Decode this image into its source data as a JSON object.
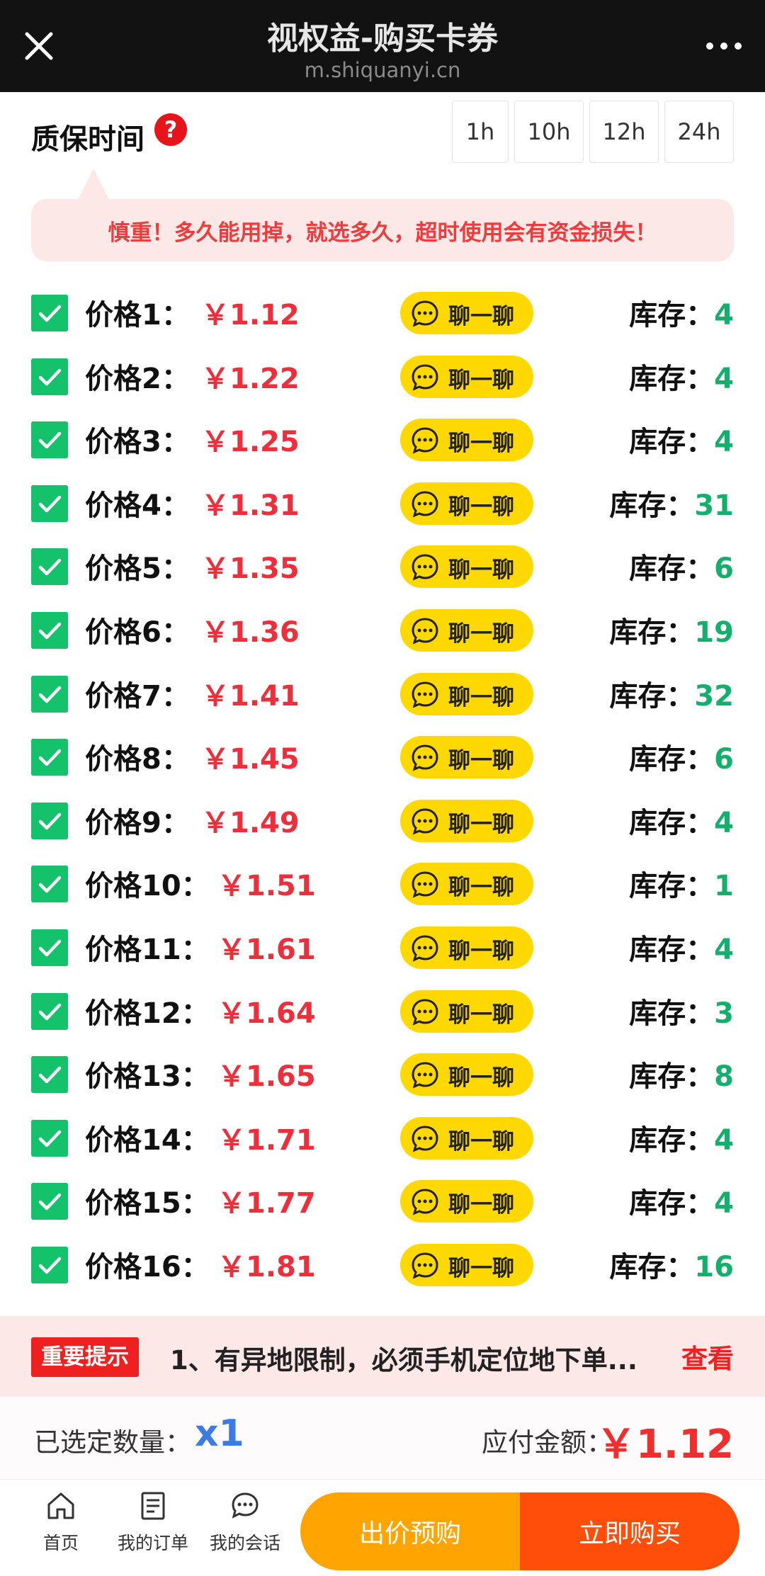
{
  "titlebar": {
    "title": "视权益-购买卡券",
    "url": "m.shiquanyi.cn"
  },
  "warranty": {
    "label": "质保时间",
    "help": "?",
    "options": [
      "1h",
      "10h",
      "12h",
      "24h"
    ],
    "notice": "慎重！多久能用掉，就选多久，超时使用会有资金损失！"
  },
  "list": {
    "chat_label": "聊一聊",
    "stock_label": "库存：",
    "items": [
      {
        "label": "价格1：",
        "price": "￥1.12",
        "stock": "4"
      },
      {
        "label": "价格2：",
        "price": "￥1.22",
        "stock": "4"
      },
      {
        "label": "价格3：",
        "price": "￥1.25",
        "stock": "4"
      },
      {
        "label": "价格4：",
        "price": "￥1.31",
        "stock": "31"
      },
      {
        "label": "价格5：",
        "price": "￥1.35",
        "stock": "6"
      },
      {
        "label": "价格6：",
        "price": "￥1.36",
        "stock": "19"
      },
      {
        "label": "价格7：",
        "price": "￥1.41",
        "stock": "32"
      },
      {
        "label": "价格8：",
        "price": "￥1.45",
        "stock": "6"
      },
      {
        "label": "价格9：",
        "price": "￥1.49",
        "stock": "4"
      },
      {
        "label": "价格10：",
        "price": "￥1.51",
        "stock": "1"
      },
      {
        "label": "价格11：",
        "price": "￥1.61",
        "stock": "4"
      },
      {
        "label": "价格12：",
        "price": "￥1.64",
        "stock": "3"
      },
      {
        "label": "价格13：",
        "price": "￥1.65",
        "stock": "8"
      },
      {
        "label": "价格14：",
        "price": "￥1.71",
        "stock": "4"
      },
      {
        "label": "价格15：",
        "price": "￥1.77",
        "stock": "4"
      },
      {
        "label": "价格16：",
        "price": "￥1.81",
        "stock": "16"
      }
    ]
  },
  "tip": {
    "badge": "重要提示",
    "text": "1、有异地限制，必须手机定位地下单...",
    "view": "查看"
  },
  "summary": {
    "qty_label": "已选定数量：",
    "qty_value": "x1",
    "amount_label": "应付金额：",
    "amount_value": "￥1.12"
  },
  "nav": {
    "home": "首页",
    "orders": "我的订单",
    "chats": "我的会话",
    "bid": "出价预购",
    "buy": "立即购买"
  },
  "colors": {
    "checkbox": "#13c26a",
    "price": "#ef2e3b",
    "chat_button": "#ffd800",
    "stock_number": "#13b06c",
    "bid_button": "#ffa400",
    "buy_button": "#ff4d0a"
  }
}
